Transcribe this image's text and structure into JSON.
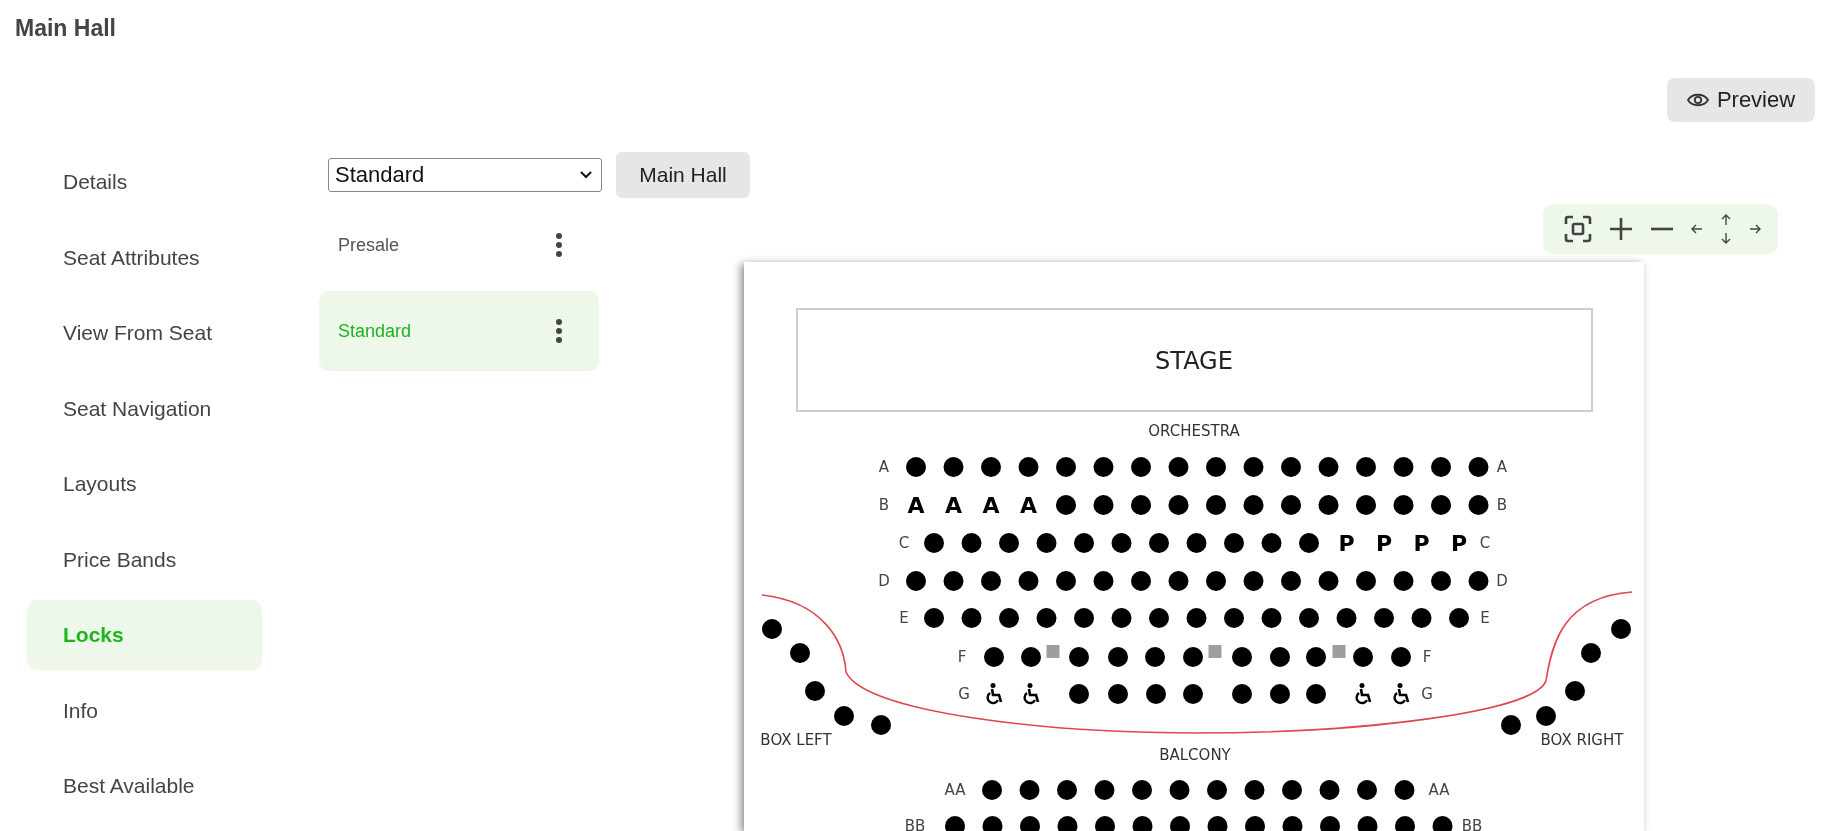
{
  "page_title": "Main Hall",
  "preview_button": {
    "label": "Preview"
  },
  "sidebar": {
    "items": [
      {
        "label": "Details",
        "selected": false
      },
      {
        "label": "Seat Attributes",
        "selected": false
      },
      {
        "label": "View From Seat",
        "selected": false
      },
      {
        "label": "Seat Navigation",
        "selected": false
      },
      {
        "label": "Layouts",
        "selected": false
      },
      {
        "label": "Price Bands",
        "selected": false
      },
      {
        "label": "Locks",
        "selected": true
      },
      {
        "label": "Info",
        "selected": false
      },
      {
        "label": "Best Available",
        "selected": false
      }
    ]
  },
  "layout_select": {
    "value": "Standard"
  },
  "venue_button": {
    "label": "Main Hall"
  },
  "lock_lists": [
    {
      "label": "Presale",
      "selected": false
    },
    {
      "label": "Standard",
      "selected": true
    }
  ],
  "seat_map": {
    "stage": "STAGE",
    "orchestra_label": "ORCHESTRA",
    "balcony_label": "BALCONY",
    "rows": [
      {
        "left_label": "A",
        "right_label": "A",
        "seats": [
          {
            "kind": "seat"
          },
          {
            "kind": "seat"
          },
          {
            "kind": "seat"
          },
          {
            "kind": "seat"
          },
          {
            "kind": "seat"
          },
          {
            "kind": "seat"
          },
          {
            "kind": "seat"
          },
          {
            "kind": "seat"
          },
          {
            "kind": "seat"
          },
          {
            "kind": "seat"
          },
          {
            "kind": "seat"
          },
          {
            "kind": "seat"
          },
          {
            "kind": "seat"
          },
          {
            "kind": "seat"
          },
          {
            "kind": "seat"
          },
          {
            "kind": "seat"
          }
        ]
      },
      {
        "left_label": "B",
        "right_label": "B",
        "seats": [
          {
            "kind": "letter",
            "text": "A"
          },
          {
            "kind": "letter",
            "text": "A"
          },
          {
            "kind": "letter",
            "text": "A"
          },
          {
            "kind": "letter",
            "text": "A"
          },
          {
            "kind": "seat"
          },
          {
            "kind": "seat"
          },
          {
            "kind": "seat"
          },
          {
            "kind": "seat"
          },
          {
            "kind": "seat"
          },
          {
            "kind": "seat"
          },
          {
            "kind": "seat"
          },
          {
            "kind": "seat"
          },
          {
            "kind": "seat"
          },
          {
            "kind": "seat"
          },
          {
            "kind": "seat"
          },
          {
            "kind": "seat"
          }
        ]
      },
      {
        "left_label": "C",
        "right_label": "C",
        "seats": [
          {
            "kind": "seat"
          },
          {
            "kind": "seat"
          },
          {
            "kind": "seat"
          },
          {
            "kind": "seat"
          },
          {
            "kind": "seat"
          },
          {
            "kind": "seat"
          },
          {
            "kind": "seat"
          },
          {
            "kind": "seat"
          },
          {
            "kind": "seat"
          },
          {
            "kind": "seat"
          },
          {
            "kind": "seat"
          },
          {
            "kind": "letter",
            "text": "P"
          },
          {
            "kind": "letter",
            "text": "P"
          },
          {
            "kind": "letter",
            "text": "P"
          },
          {
            "kind": "letter",
            "text": "P"
          }
        ]
      },
      {
        "left_label": "D",
        "right_label": "D",
        "seats": [
          {
            "kind": "seat"
          },
          {
            "kind": "seat"
          },
          {
            "kind": "seat"
          },
          {
            "kind": "seat"
          },
          {
            "kind": "seat"
          },
          {
            "kind": "seat"
          },
          {
            "kind": "seat"
          },
          {
            "kind": "seat"
          },
          {
            "kind": "seat"
          },
          {
            "kind": "seat"
          },
          {
            "kind": "seat"
          },
          {
            "kind": "seat"
          },
          {
            "kind": "seat"
          },
          {
            "kind": "seat"
          },
          {
            "kind": "seat"
          },
          {
            "kind": "seat"
          }
        ]
      },
      {
        "left_label": "E",
        "right_label": "E",
        "seats": [
          {
            "kind": "seat"
          },
          {
            "kind": "seat"
          },
          {
            "kind": "seat"
          },
          {
            "kind": "seat"
          },
          {
            "kind": "seat"
          },
          {
            "kind": "seat"
          },
          {
            "kind": "seat"
          },
          {
            "kind": "seat"
          },
          {
            "kind": "seat"
          },
          {
            "kind": "seat"
          },
          {
            "kind": "seat"
          },
          {
            "kind": "seat"
          },
          {
            "kind": "seat"
          },
          {
            "kind": "seat"
          },
          {
            "kind": "seat"
          }
        ]
      },
      {
        "left_label": "F",
        "right_label": "F",
        "seats": [
          {
            "kind": "seat"
          },
          {
            "kind": "seat"
          },
          {
            "kind": "blocked"
          },
          {
            "kind": "seat"
          },
          {
            "kind": "seat"
          },
          {
            "kind": "seat"
          },
          {
            "kind": "seat"
          },
          {
            "kind": "blocked"
          },
          {
            "kind": "seat"
          },
          {
            "kind": "seat"
          },
          {
            "kind": "seat"
          },
          {
            "kind": "blocked"
          },
          {
            "kind": "seat"
          },
          {
            "kind": "seat"
          }
        ]
      },
      {
        "left_label": "G",
        "right_label": "G",
        "seats": [
          {
            "kind": "wheelchair"
          },
          {
            "kind": "wheelchair"
          },
          {
            "kind": "seat"
          },
          {
            "kind": "seat"
          },
          {
            "kind": "seat"
          },
          {
            "kind": "seat"
          },
          {
            "kind": "seat"
          },
          {
            "kind": "seat"
          },
          {
            "kind": "seat"
          },
          {
            "kind": "wheelchair"
          },
          {
            "kind": "wheelchair"
          }
        ]
      },
      {
        "left_label": "AA",
        "right_label": "AA",
        "seats": [
          {
            "kind": "seat"
          },
          {
            "kind": "seat"
          },
          {
            "kind": "seat"
          },
          {
            "kind": "seat"
          },
          {
            "kind": "seat"
          },
          {
            "kind": "seat"
          },
          {
            "kind": "seat"
          },
          {
            "kind": "seat"
          },
          {
            "kind": "seat"
          },
          {
            "kind": "seat"
          },
          {
            "kind": "seat"
          },
          {
            "kind": "seat"
          }
        ]
      },
      {
        "left_label": "BB",
        "right_label": "BB",
        "seats": [
          {
            "kind": "seat"
          },
          {
            "kind": "seat"
          },
          {
            "kind": "seat"
          },
          {
            "kind": "seat"
          },
          {
            "kind": "seat"
          },
          {
            "kind": "seat"
          },
          {
            "kind": "seat"
          },
          {
            "kind": "seat"
          },
          {
            "kind": "seat"
          },
          {
            "kind": "seat"
          },
          {
            "kind": "seat"
          },
          {
            "kind": "seat"
          },
          {
            "kind": "seat"
          },
          {
            "kind": "seat"
          }
        ]
      }
    ],
    "boxes": [
      {
        "label": "BOX LEFT",
        "seats": [
          {
            "kind": "seat"
          },
          {
            "kind": "seat"
          },
          {
            "kind": "seat"
          },
          {
            "kind": "seat"
          },
          {
            "kind": "seat"
          }
        ]
      },
      {
        "label": "BOX RIGHT",
        "seats": [
          {
            "kind": "seat"
          },
          {
            "kind": "seat"
          },
          {
            "kind": "seat"
          },
          {
            "kind": "seat"
          },
          {
            "kind": "seat"
          }
        ]
      }
    ]
  }
}
